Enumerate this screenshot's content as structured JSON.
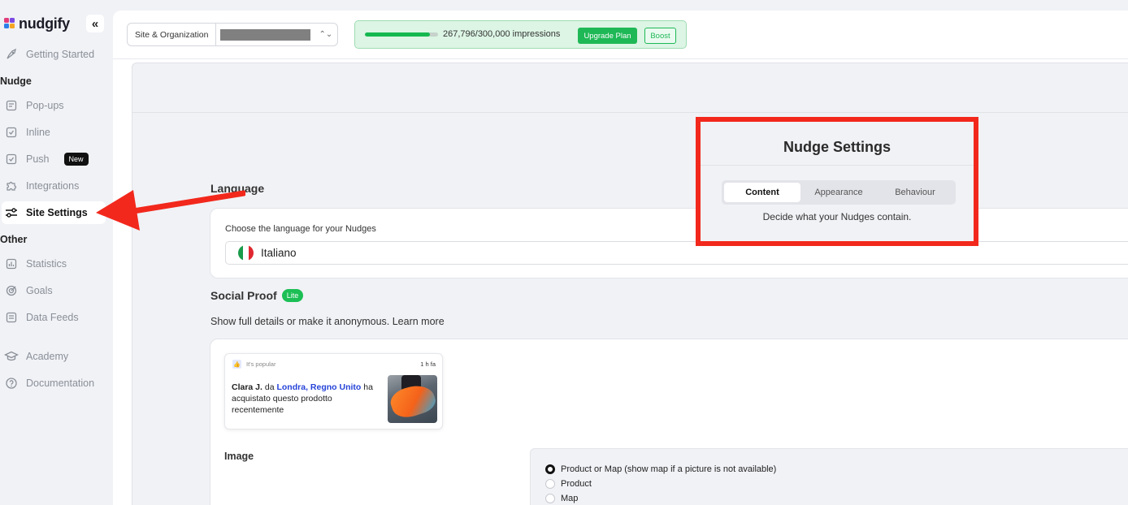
{
  "app": {
    "logo_text": "nudgify"
  },
  "sidebar": {
    "collapse_label": "«",
    "getting_started": "Getting Started",
    "section_nudge": "Nudge",
    "items_nudge": [
      {
        "label": "Pop-ups",
        "icon": "popup-icon"
      },
      {
        "label": "Inline",
        "icon": "inline-icon"
      },
      {
        "label": "Push",
        "icon": "push-icon",
        "badge": "New"
      },
      {
        "label": "Integrations",
        "icon": "puzzle-icon"
      },
      {
        "label": "Site Settings",
        "icon": "sliders-icon",
        "active": true
      }
    ],
    "section_other": "Other",
    "items_other": [
      {
        "label": "Statistics",
        "icon": "chart-icon"
      },
      {
        "label": "Goals",
        "icon": "target-icon"
      },
      {
        "label": "Data Feeds",
        "icon": "feed-icon"
      }
    ],
    "items_bottom": [
      {
        "label": "Academy",
        "icon": "graduation-cap-icon"
      },
      {
        "label": "Documentation",
        "icon": "help-icon"
      }
    ]
  },
  "topbar": {
    "site_label": "Site & Organization",
    "usage_fraction": 0.893,
    "impressions_text": "267,796/300,000 impressions",
    "upgrade_label": "Upgrade Plan",
    "boost_label": "Boost"
  },
  "settings": {
    "title": "Nudge Settings",
    "tabs": [
      "Content",
      "Appearance",
      "Behaviour"
    ],
    "active_tab": "Content",
    "description": "Decide what your Nudges contain."
  },
  "language": {
    "heading": "Language",
    "label": "Choose the language for your Nudges",
    "value": "Italiano"
  },
  "social_proof": {
    "heading": "Social Proof",
    "badge": "Lite",
    "description": "Show full details or make it anonymous. Learn more",
    "preview": {
      "tag": "It's popular",
      "time": "1 h fa",
      "name": "Clara J.",
      "da": "da",
      "location": "Londra, Regno Unito",
      "text_after": "ha acquistato questo prodotto recentemente"
    },
    "image_heading": "Image",
    "image_options": [
      {
        "label": "Product or Map (show map if a picture is not available)",
        "selected": true
      },
      {
        "label": "Product",
        "selected": false
      },
      {
        "label": "Map",
        "selected": false
      }
    ]
  },
  "colors": {
    "accent_green": "#1fb856",
    "annotation_red": "#f2281c",
    "link_blue": "#2643d8"
  }
}
